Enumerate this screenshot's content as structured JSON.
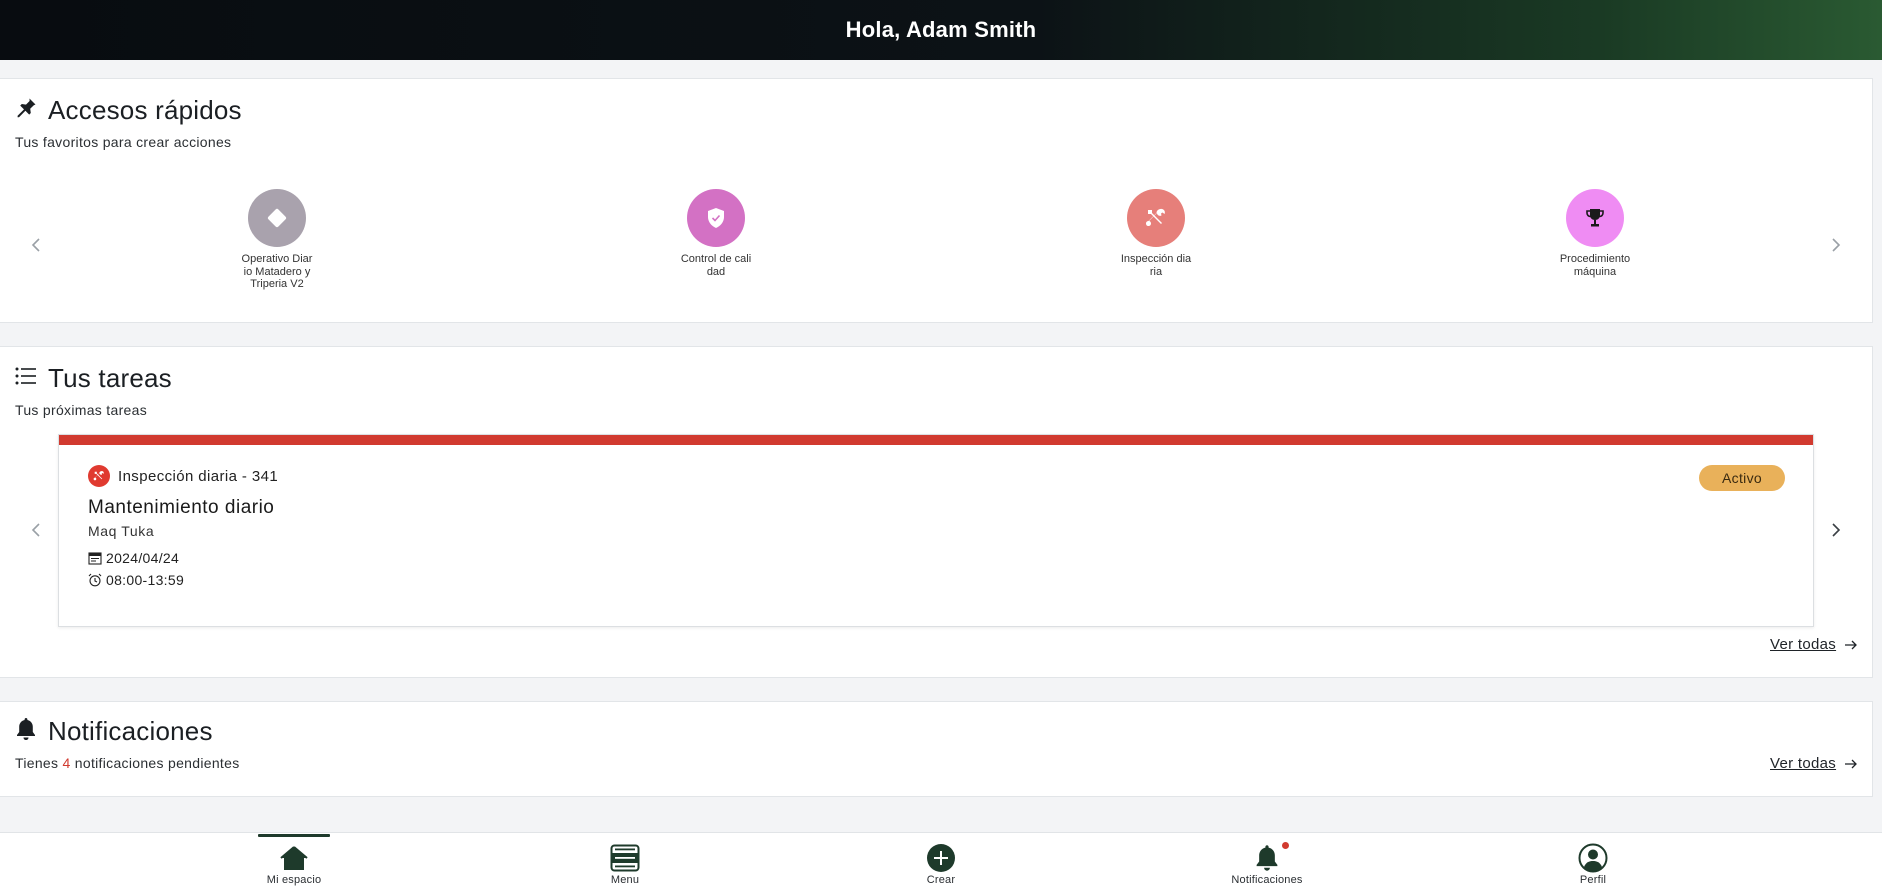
{
  "header": {
    "greeting": "Hola, Adam Smith"
  },
  "quick_access": {
    "title": "Accesos rápidos",
    "subtitle": "Tus favoritos para crear acciones",
    "items": [
      {
        "label": "Operativo Diario Matadero y Triperia V2",
        "icon": "diamond-icon",
        "color": "#a9a2ad"
      },
      {
        "label": "Control de calidad",
        "icon": "shield-check-icon",
        "color": "#d371c4"
      },
      {
        "label": "Inspección diaria",
        "icon": "wrench-screwdriver-icon",
        "color": "#e67f7a"
      },
      {
        "label": "Procedimiento máquina",
        "icon": "trophy-icon",
        "color": "#ef8cf3"
      }
    ]
  },
  "tasks": {
    "title": "Tus tareas",
    "subtitle": "Tus próximas tareas",
    "card": {
      "type_label": "Inspección diaria - 341",
      "title": "Mantenimiento diario",
      "subtitle": "Maq Tuka",
      "date": "2024/04/24",
      "time": "08:00-13:59",
      "status": "Activo",
      "accent_color": "#d13a2f",
      "status_color": "#e9b15a"
    },
    "see_all": "Ver todas"
  },
  "notifications": {
    "title": "Notificaciones",
    "text_before": "Tienes ",
    "count": "4",
    "text_after": " notificaciones pendientes",
    "see_all": "Ver todas"
  },
  "bottom_nav": {
    "items": [
      {
        "label": "Mi espacio",
        "icon": "home-icon",
        "active": true
      },
      {
        "label": "Menu",
        "icon": "menu-list-icon",
        "active": false
      },
      {
        "label": "Crear",
        "icon": "plus-circle-icon",
        "active": false
      },
      {
        "label": "Notificaciones",
        "icon": "bell-icon",
        "active": false
      },
      {
        "label": "Perfil",
        "icon": "user-circle-icon",
        "active": false
      }
    ]
  }
}
